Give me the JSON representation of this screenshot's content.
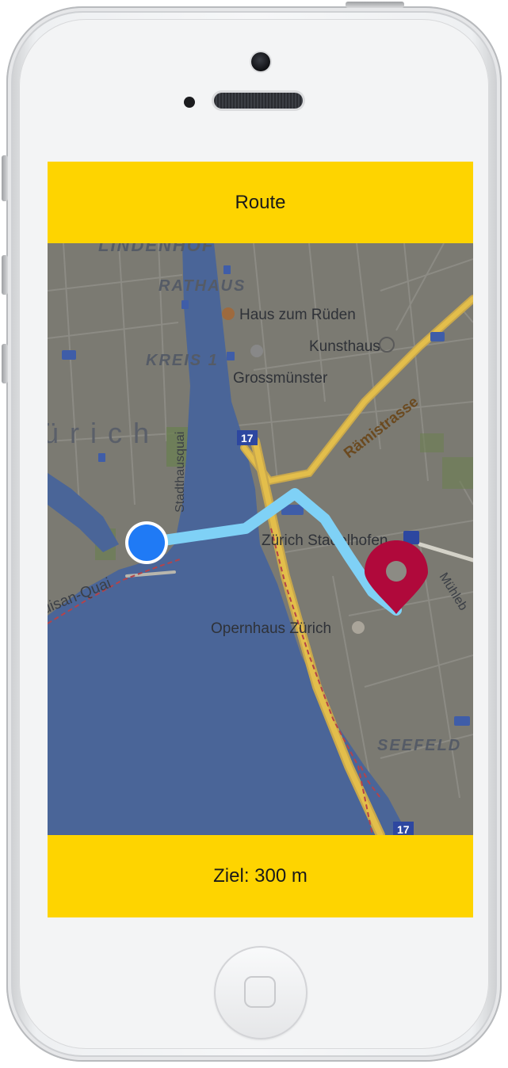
{
  "app": {
    "title": "Route",
    "status": "Ziel: 300 m"
  },
  "map": {
    "labels": {
      "lindenhof": "LINDENHOF",
      "rathaus": "RATHAUS",
      "haus_zum_rueden": "Haus zum Rüden",
      "kunsthaus": "Kunsthaus",
      "kreis1": "KREIS 1",
      "grossmuenster": "Grossmünster",
      "raemistrasse": "Rämistrasse",
      "zuerich": "ürich",
      "stadthausquai": "Stadthausquai",
      "route17_a": "17",
      "route17_b": "17",
      "zuerich_stadelhofen": "Zürich Stadelhofen",
      "quai": "uisan-Quai",
      "opernhaus": "Opernhaus Zürich",
      "muehlebach": "Mühleb",
      "seefeld": "SEEFELD"
    },
    "colors": {
      "route": "#7fd1f6",
      "origin": "#1f7af5",
      "destination": "#b0093b",
      "bar": "#fed400"
    },
    "icons": {
      "origin": "current-location-icon",
      "destination": "destination-pin-icon"
    }
  }
}
